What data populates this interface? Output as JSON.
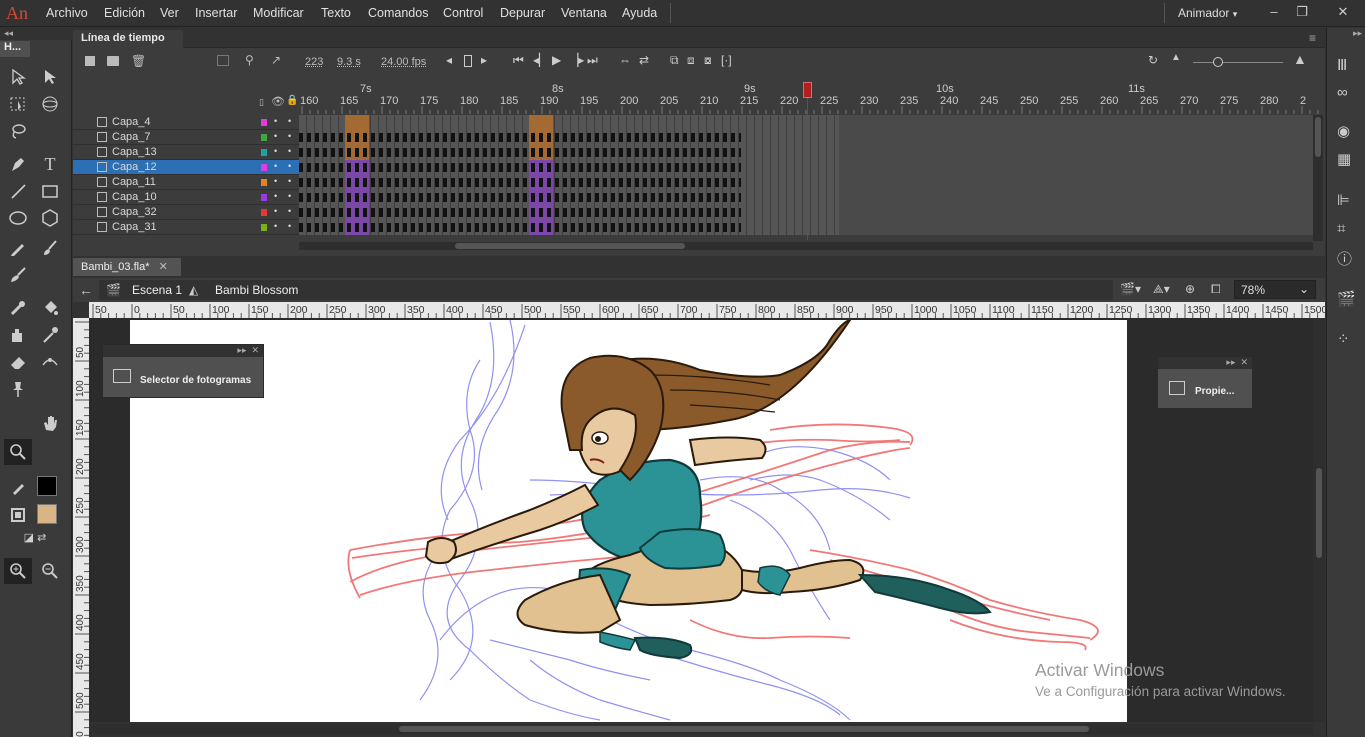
{
  "app": {
    "logo": "An"
  },
  "menu": [
    "Archivo",
    "Edición",
    "Ver",
    "Insertar",
    "Modificar",
    "Texto",
    "Comandos",
    "Control",
    "Depurar",
    "Ventana",
    "Ayuda"
  ],
  "workspace": {
    "label": "Animador"
  },
  "tools_panel": {
    "title": "H..."
  },
  "timeline": {
    "title": "Línea de tiempo",
    "frame": "223",
    "time": "9.3 s",
    "fps": "24.00 fps",
    "seconds": [
      "7s",
      "8s",
      "9s",
      "10s",
      "11s"
    ],
    "frame_numbers": [
      "160",
      "165",
      "170",
      "175",
      "180",
      "185",
      "190",
      "195",
      "200",
      "205",
      "210",
      "215",
      "220",
      "225",
      "230",
      "235",
      "240",
      "245",
      "250",
      "255",
      "260",
      "265",
      "270",
      "275",
      "280",
      "2"
    ],
    "layers": [
      {
        "name": "Capa_4",
        "color": "#e23ae2",
        "selected": false
      },
      {
        "name": "Capa_7",
        "color": "#3fa93f",
        "selected": false
      },
      {
        "name": "Capa_13",
        "color": "#1aa3a3",
        "selected": false
      },
      {
        "name": "Capa_12",
        "color": "#e23ae2",
        "selected": true
      },
      {
        "name": "Capa_11",
        "color": "#e8821a",
        "selected": false
      },
      {
        "name": "Capa_10",
        "color": "#9b3ae2",
        "selected": false
      },
      {
        "name": "Capa_32",
        "color": "#e23a3a",
        "selected": false
      },
      {
        "name": "Capa_31",
        "color": "#7ab01a",
        "selected": false
      }
    ]
  },
  "document": {
    "tab": "Bambi_03.fla*",
    "scene": "Escena 1",
    "symbol": "Bambi Blossom",
    "zoom": "78%",
    "hruler": [
      "50",
      "0",
      "50",
      "100",
      "150",
      "200",
      "250",
      "300",
      "350",
      "400",
      "450",
      "500",
      "550",
      "600",
      "650",
      "700",
      "750",
      "800",
      "850",
      "900",
      "950",
      "1000",
      "1050",
      "1100",
      "1150",
      "1200",
      "1250",
      "1300",
      "1350",
      "1400",
      "1450",
      "1500"
    ],
    "vruler": [
      "50",
      "100",
      "150",
      "200",
      "250",
      "300",
      "350",
      "400",
      "450",
      "500",
      "550"
    ]
  },
  "panels": {
    "frame_picker": "Selector de fotogramas",
    "properties": "Propie..."
  },
  "watermark": {
    "line1": "Activar Windows",
    "line2": "Ve a Configuración para activar Windows."
  },
  "colors": {
    "stroke": "#000000",
    "fill": "#d8b486",
    "accent": "#2d6fb5",
    "playhead": "#b51e1e"
  }
}
